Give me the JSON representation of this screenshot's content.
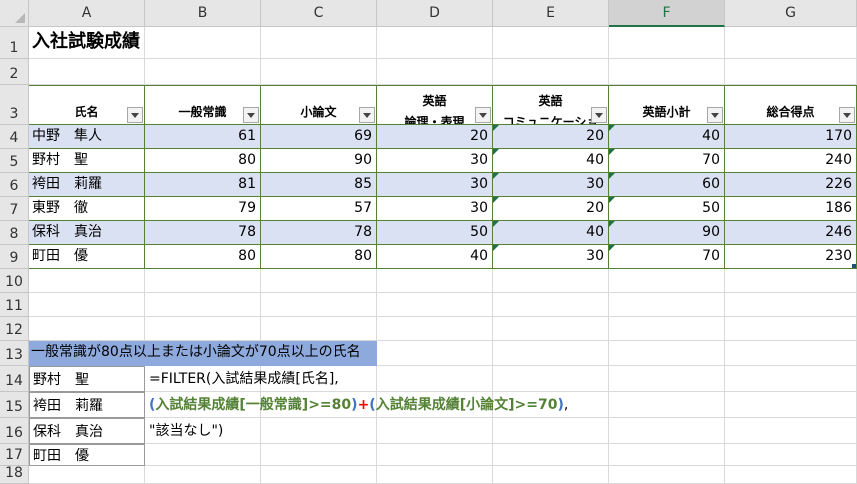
{
  "columns": [
    "A",
    "B",
    "C",
    "D",
    "E",
    "F",
    "G"
  ],
  "rows": [
    "1",
    "2",
    "3",
    "4",
    "5",
    "6",
    "7",
    "8",
    "9",
    "10",
    "11",
    "12",
    "13",
    "14",
    "15",
    "16",
    "17",
    "18"
  ],
  "title": "入社試験成績",
  "headers": [
    {
      "lines": [
        "氏名"
      ]
    },
    {
      "lines": [
        "一般常識"
      ]
    },
    {
      "lines": [
        "小論文"
      ]
    },
    {
      "lines": [
        "英語",
        "論理・表現"
      ]
    },
    {
      "lines": [
        "英語",
        "コミュニケーショ"
      ]
    },
    {
      "lines": [
        "英語小計"
      ]
    },
    {
      "lines": [
        "総合得点"
      ]
    }
  ],
  "table_rows": [
    {
      "name": "中野　隼人",
      "general": "61",
      "essay": "69",
      "eng_logic": "20",
      "eng_comm": "20",
      "eng_total": "40",
      "total": "170"
    },
    {
      "name": "野村　聖",
      "general": "80",
      "essay": "90",
      "eng_logic": "30",
      "eng_comm": "40",
      "eng_total": "70",
      "total": "240"
    },
    {
      "name": "袴田　莉羅",
      "general": "81",
      "essay": "85",
      "eng_logic": "30",
      "eng_comm": "30",
      "eng_total": "60",
      "total": "226"
    },
    {
      "name": "東野　徹",
      "general": "79",
      "essay": "57",
      "eng_logic": "30",
      "eng_comm": "20",
      "eng_total": "50",
      "total": "186"
    },
    {
      "name": "保科　真治",
      "general": "78",
      "essay": "78",
      "eng_logic": "50",
      "eng_comm": "40",
      "eng_total": "90",
      "total": "246"
    },
    {
      "name": "町田　優",
      "general": "80",
      "essay": "80",
      "eng_logic": "40",
      "eng_comm": "30",
      "eng_total": "70",
      "total": "230"
    }
  ],
  "criteria_label": "一般常識が80点以上または小論文が70点以上の氏名",
  "results": [
    "野村　聖",
    "袴田　莉羅",
    "保科　真治",
    "町田　優"
  ],
  "formula": {
    "line1": "=FILTER(入試結果成績[氏名],",
    "p_open1": "(",
    "cond1": "入試結果成績[一般常識]>=80",
    "p_close1": ")",
    "plus": "+",
    "p_open2": "(",
    "cond2": "入試結果成績[小論文]>=70",
    "p_close2": ")",
    "comma": ",",
    "line3": "\"該当なし\")"
  },
  "colors": {
    "band": "#d9e1f2",
    "table_border": "#548235",
    "criteria_bg": "#8ea9db",
    "formula_blue": "#4472c4",
    "formula_green": "#548235",
    "formula_red": "#ff0000"
  },
  "icons": [
    "filter-dropdown-icon",
    "error-indicator-icon",
    "table-resize-handle-icon"
  ]
}
